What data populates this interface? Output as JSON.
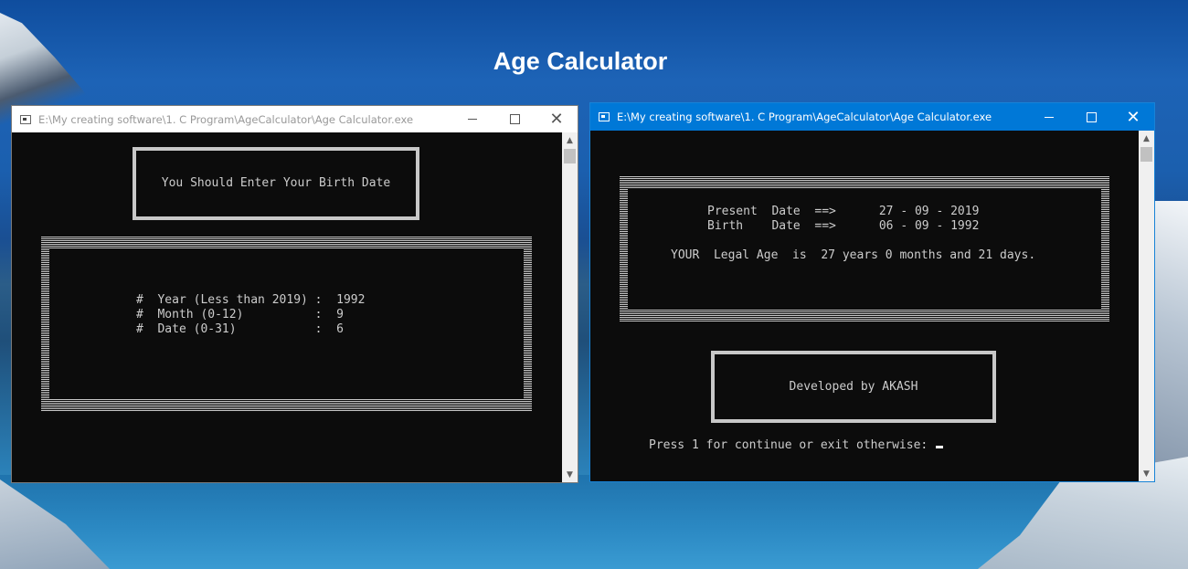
{
  "page": {
    "title": "Age Calculator"
  },
  "left_window": {
    "title": "E:\\My creating software\\1. C Program\\AgeCalculator\\Age Calculator.exe",
    "header_box": "You Should Enter Your Birth Date",
    "inputs": [
      {
        "prefix": "#",
        "label": "Year (Less than 2019) :",
        "value": "1992"
      },
      {
        "prefix": "#",
        "label": "Month (0-12)          :",
        "value": "9"
      },
      {
        "prefix": "#",
        "label": "Date (0-31)           :",
        "value": "6"
      }
    ]
  },
  "right_window": {
    "title": "E:\\My creating software\\1. C Program\\AgeCalculator\\Age Calculator.exe",
    "present_line": "Present  Date  ==>      27 - 09 - 2019",
    "birth_line": "Birth    Date  ==>      06 - 09 - 1992",
    "age_line": "YOUR  Legal Age  is  27 years 0 months and 21 days.",
    "developer_box": "Developed by AKASH",
    "prompt": "Press 1 for continue or exit otherwise: "
  },
  "icons": {
    "minimize": "minimize-icon",
    "maximize": "maximize-icon",
    "close": "close-icon",
    "console_app": "console-app-icon"
  },
  "colors": {
    "console_bg": "#0c0c0c",
    "console_text": "#cccccc",
    "active_titlebar": "#0078d7",
    "inactive_titlebar": "#ffffff",
    "page_title": "#ffffff"
  }
}
